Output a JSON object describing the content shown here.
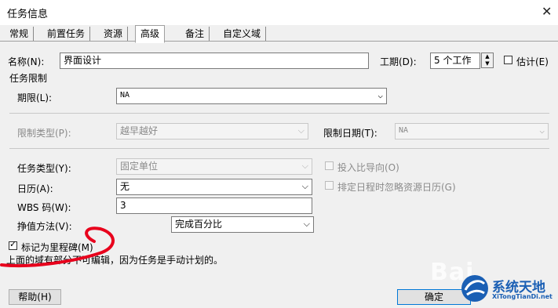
{
  "window": {
    "title": "任务信息"
  },
  "tabs": [
    {
      "label": "常规"
    },
    {
      "label": "前置任务"
    },
    {
      "label": "资源"
    },
    {
      "label": "高级"
    },
    {
      "label": "备注"
    },
    {
      "label": "自定义域"
    }
  ],
  "name": {
    "label": "名称(N):",
    "value": "界面设计"
  },
  "duration": {
    "label": "工期(D):",
    "value": "5 个工作"
  },
  "estimate": {
    "label": "估计(E)",
    "checked": false
  },
  "constraint_section": {
    "title": "任务限制"
  },
  "deadline": {
    "label": "期限(L):",
    "value": "NA"
  },
  "constraint_type": {
    "label": "限制类型(P):",
    "value": "越早越好"
  },
  "constraint_date": {
    "label": "限制日期(T):",
    "value": "NA"
  },
  "task_type": {
    "label": "任务类型(Y):",
    "value": "固定单位"
  },
  "effort_driven": {
    "label": "投入比导向(O)",
    "checked": false
  },
  "calendar": {
    "label": "日历(A):",
    "value": "无"
  },
  "ignore_resource_calendar": {
    "label": "排定日程时忽略资源日历(G)",
    "checked": false
  },
  "wbs": {
    "label": "WBS 码(W):",
    "value": "3"
  },
  "earned_value": {
    "label": "挣值方法(V):",
    "value": "完成百分比"
  },
  "milestone": {
    "label": "标记为里程碑(M)",
    "checked": true
  },
  "notice": "上面的域有部分不可编辑，因为任务是手动计划的。",
  "buttons": {
    "help": "帮助(H)",
    "ok": "确定"
  },
  "watermark": {
    "text": "Bai",
    "brand": "系统天地",
    "url": "XiTongTianDi.net"
  },
  "colors": {
    "annotation": "#e8001c",
    "brand": "#1a5fb4"
  }
}
